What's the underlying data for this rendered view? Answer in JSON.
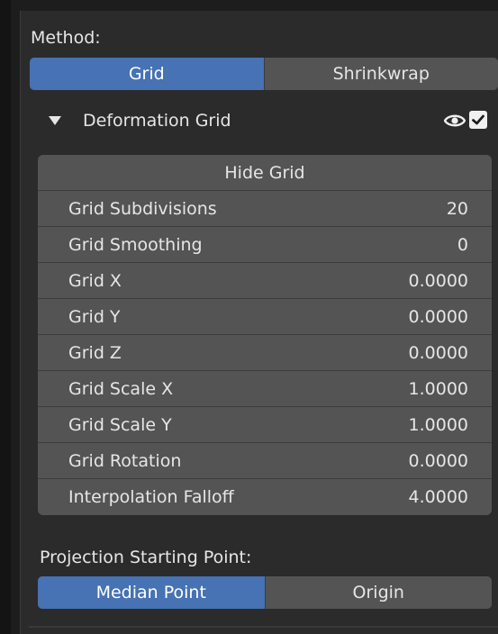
{
  "method": {
    "label": "Method:",
    "options": [
      "Grid",
      "Shrinkwrap"
    ],
    "selected": "Grid"
  },
  "subpanel": {
    "title": "Deformation Grid",
    "visible": true,
    "enabled": true
  },
  "grid": {
    "hide_button": "Hide Grid",
    "rows": [
      {
        "name": "Grid Subdivisions",
        "value": "20"
      },
      {
        "name": "Grid Smoothing",
        "value": "0"
      },
      {
        "name": "Grid X",
        "value": "0.0000"
      },
      {
        "name": "Grid Y",
        "value": "0.0000"
      },
      {
        "name": "Grid Z",
        "value": "0.0000"
      },
      {
        "name": "Grid Scale X",
        "value": "1.0000"
      },
      {
        "name": "Grid Scale Y",
        "value": "1.0000"
      },
      {
        "name": "Grid Rotation",
        "value": "0.0000"
      },
      {
        "name": "Interpolation Falloff",
        "value": "4.0000"
      }
    ]
  },
  "projection": {
    "label": "Projection Starting Point:",
    "options": [
      "Median Point",
      "Origin"
    ],
    "selected": "Median Point"
  },
  "colors": {
    "accent": "#4772b3",
    "field": "#545454",
    "panel": "#2b2b2b",
    "background": "#1d1d1d"
  }
}
